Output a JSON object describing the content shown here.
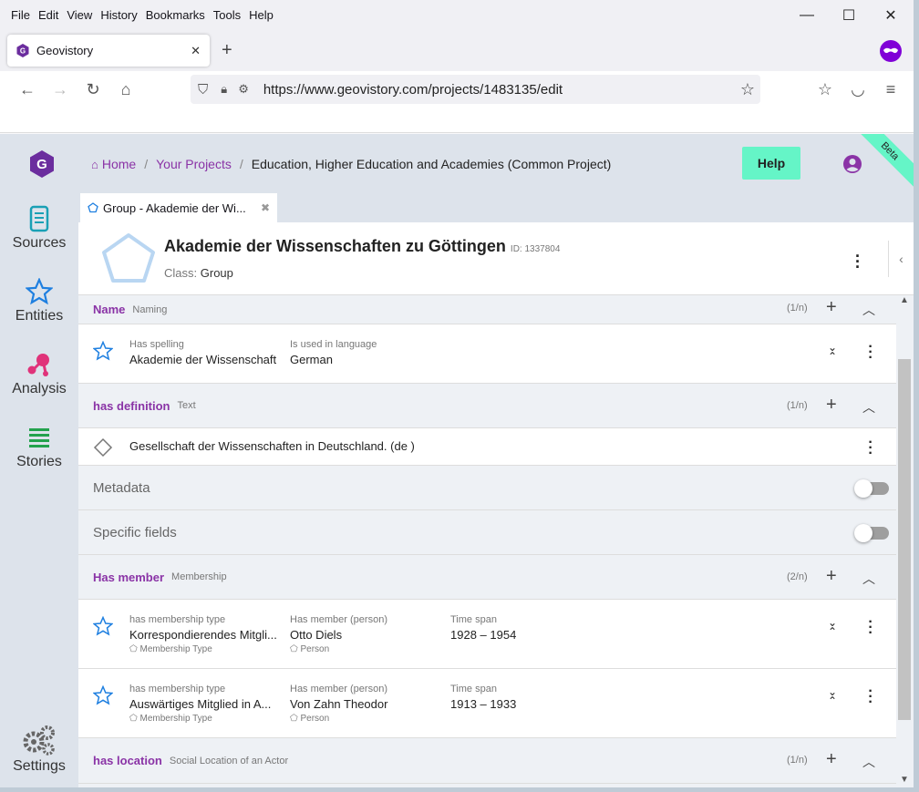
{
  "browser": {
    "menu": [
      "File",
      "Edit",
      "View",
      "History",
      "Bookmarks",
      "Tools",
      "Help"
    ],
    "tab_title": "Geovistory",
    "url": "https://www.geovistory.com/projects/1483135/edit"
  },
  "header": {
    "breadcrumb": {
      "home": "Home",
      "projects": "Your Projects",
      "current": "Education, Higher Education and Academies (Common Project)",
      "sep": "/"
    },
    "help_label": "Help",
    "beta_label": "Beta",
    "accent": "#65f5c7",
    "brand": "#8a33a6"
  },
  "sidebar": {
    "items": [
      {
        "label": "Sources",
        "icon": "scroll-icon"
      },
      {
        "label": "Entities",
        "icon": "star-outline-icon"
      },
      {
        "label": "Analysis",
        "icon": "molecule-icon"
      },
      {
        "label": "Stories",
        "icon": "lines-icon"
      }
    ],
    "settings_label": "Settings"
  },
  "panel_tab": {
    "label": "Group - Akademie der Wi...",
    "close": "✖"
  },
  "entity": {
    "title": "Akademie der Wissenschaften zu Göttingen",
    "id_label": "ID: 1337804",
    "class_prefix": "Class:",
    "class_value": "Group"
  },
  "sections": {
    "name": {
      "title": "Name",
      "subtitle": "Naming",
      "count": "(1/n)"
    },
    "name_row": {
      "f1_label": "Has spelling",
      "f1_value": "Akademie der Wissenschaft",
      "f2_label": "Is used in language",
      "f2_value": "German"
    },
    "definition": {
      "title": "has definition",
      "subtitle": "Text",
      "count": "(1/n)"
    },
    "definition_row": {
      "value": "Gesellschaft der Wissenschaften in Deutschland. (de )"
    },
    "metadata_label": "Metadata",
    "specific_label": "Specific fields",
    "member": {
      "title": "Has member",
      "subtitle": "Membership",
      "count": "(2/n)"
    },
    "member_rows": [
      {
        "f1_label": "has membership type",
        "f1_value": "Korrespondierendes Mitgli...",
        "f1_sub": "Membership Type",
        "f2_label": "Has member (person)",
        "f2_value": "Otto Diels",
        "f2_sub": "Person",
        "f3_label": "Time span",
        "f3_value": "1928 – 1954"
      },
      {
        "f1_label": "has membership type",
        "f1_value": "Auswärtiges Mitglied in A...",
        "f1_sub": "Membership Type",
        "f2_label": "Has member (person)",
        "f2_value": "Von Zahn Theodor",
        "f2_sub": "Person",
        "f3_label": "Time span",
        "f3_value": "1913 – 1933"
      }
    ],
    "location": {
      "title": "has location",
      "subtitle": "Social Location of an Actor",
      "count": "(1/n)"
    }
  }
}
